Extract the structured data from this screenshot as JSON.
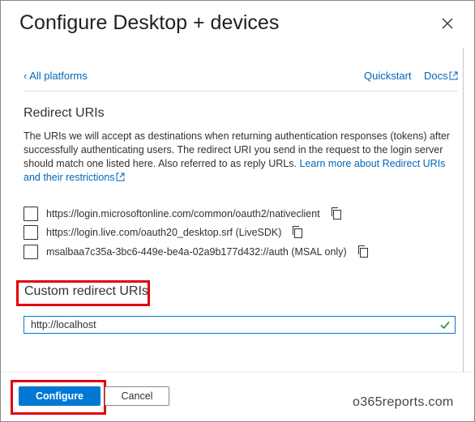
{
  "panel": {
    "title": "Configure Desktop + devices",
    "close_icon": "close-icon"
  },
  "nav": {
    "back_label": "All platforms",
    "quickstart_label": "Quickstart",
    "docs_label": "Docs"
  },
  "redirect": {
    "heading": "Redirect URIs",
    "description": "The URIs we will accept as destinations when returning authentication responses (tokens) after successfully authenticating users. The redirect URI you send in the request to the login server should match one listed here. Also referred to as reply URLs.",
    "learn_more": "Learn more about Redirect URIs and their restrictions",
    "uris": [
      {
        "text": "https://login.microsoftonline.com/common/oauth2/nativeclient",
        "checked": false
      },
      {
        "text": "https://login.live.com/oauth20_desktop.srf (LiveSDK)",
        "checked": false
      },
      {
        "text": "msalbaa7c35a-3bc6-449e-be4a-02a9b177d432://auth (MSAL only)",
        "checked": false
      }
    ]
  },
  "custom": {
    "label": "Custom redirect URIs",
    "value": "http://localhost"
  },
  "footer": {
    "configure_label": "Configure",
    "cancel_label": "Cancel"
  },
  "watermark": "o365reports.com",
  "colors": {
    "accent": "#0078d4",
    "link": "#0066b8",
    "highlight": "#e3000f",
    "valid": "#107c10"
  }
}
